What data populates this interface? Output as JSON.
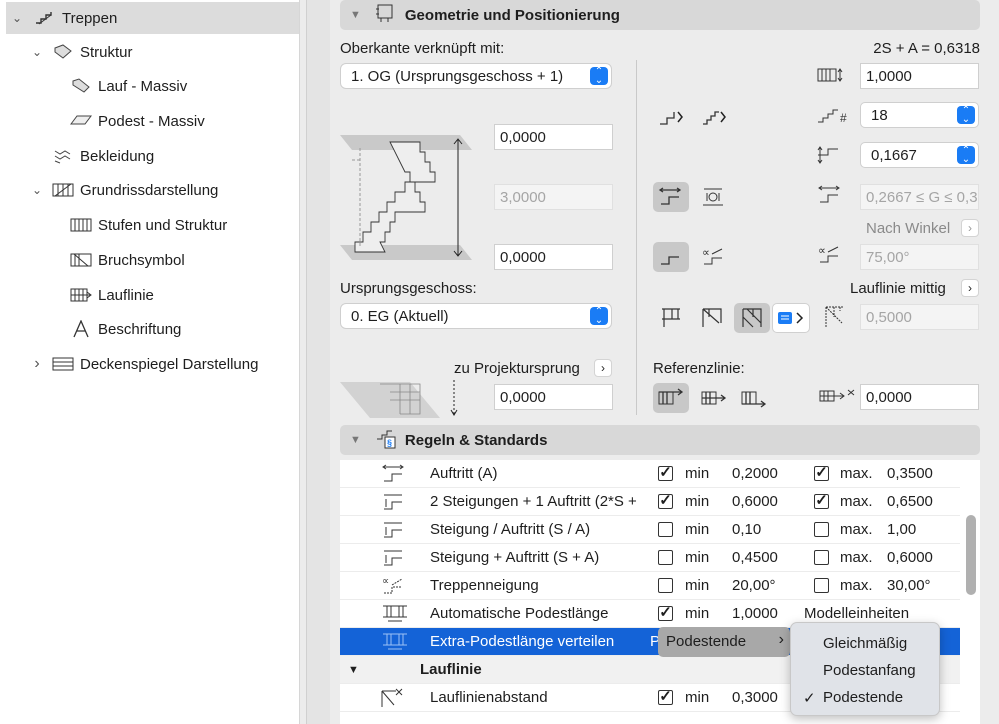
{
  "tree": {
    "items": [
      {
        "label": "Treppen",
        "chevron": "⌄",
        "icon": "stair-icon"
      },
      {
        "label": "Struktur",
        "chevron": "⌄",
        "icon": "structure-icon"
      },
      {
        "label": "Lauf - Massiv",
        "icon": "flight-icon"
      },
      {
        "label": "Podest - Massiv",
        "icon": "landing-icon"
      },
      {
        "label": "Bekleidung",
        "icon": "finish-icon"
      },
      {
        "label": "Grundrissdarstellung",
        "chevron": "⌄",
        "icon": "floorplan-icon"
      },
      {
        "label": "Stufen und Struktur",
        "icon": "treads-icon"
      },
      {
        "label": "Bruchsymbol",
        "icon": "break-mark-icon"
      },
      {
        "label": "Lauflinie",
        "icon": "walkline-icon"
      },
      {
        "label": "Beschriftung",
        "icon": "label-icon"
      },
      {
        "label": "Deckenspiegel Darstellung",
        "chevron": "›",
        "icon": "ceiling-plan-icon"
      }
    ]
  },
  "geometry": {
    "title": "Geometrie und Positionierung",
    "top_link_label": "Oberkante verknüpft mit:",
    "top_link_value": "1. OG (Ursprungsgeschoss + 1)",
    "formula": "2S + A = 0,6318",
    "top_offset": "0,0000",
    "height": "3,0000",
    "bottom_offset": "0,0000",
    "home_story_label": "Ursprungsgeschoss:",
    "home_story_value": "0. EG (Aktuell)",
    "to_project_zero_label": "zu Projektursprung",
    "to_project_zero_value": "0,0000",
    "width": "1,0000",
    "risers": "18",
    "riser_height": "0,1667",
    "going": "0,2667 ≤ G ≤ 0,3",
    "by_angle_label": "Nach Winkel",
    "angle": "75,00°",
    "walkline_center_label": "Lauflinie mittig",
    "walkline_offset": "0,5000",
    "reference_label": "Referenzlinie:",
    "reference_offset": "0,0000"
  },
  "rules": {
    "title": "Regeln & Standards",
    "min_label": "min",
    "max_label": "max.",
    "rows": [
      {
        "name": "Auftritt (A)",
        "min_checked": "✓",
        "min": "0,2000",
        "max_checked": "✓",
        "max": "0,3500"
      },
      {
        "name": "2 Steigungen + 1 Auftritt (2*S +",
        "min_checked": "✓",
        "min": "0,6000",
        "max_checked": "✓",
        "max": "0,6500"
      },
      {
        "name": "Steigung / Auftritt (S / A)",
        "min_checked": "",
        "min": "0,10",
        "max_checked": "",
        "max": "1,00"
      },
      {
        "name": "Steigung + Auftritt (S + A)",
        "min_checked": "",
        "min": "0,4500",
        "max_checked": "",
        "max": "0,6000"
      },
      {
        "name": "Treppenneigung",
        "min_checked": "",
        "min": "20,00°",
        "max_checked": "",
        "max": "30,00°"
      },
      {
        "name": "Automatische Podestlänge",
        "min_checked": "✓",
        "min": "1,0000",
        "unit": "Modelleinheiten"
      }
    ],
    "selected_row": {
      "name": "Extra-Podestlänge verteilen",
      "value_prefix": "P"
    },
    "group": {
      "label": "Lauflinie",
      "arrow": "▼"
    },
    "walkline_row": {
      "name": "Lauflinienabstand",
      "min_checked": "✓",
      "min": "0,3000"
    }
  },
  "submenu": {
    "label": "Podestende",
    "arrow": "›"
  },
  "menu": {
    "items": [
      "Gleichmäßig",
      "Podestanfang",
      "Podestende"
    ],
    "checked": "✓",
    "accent": "#1463d7"
  }
}
